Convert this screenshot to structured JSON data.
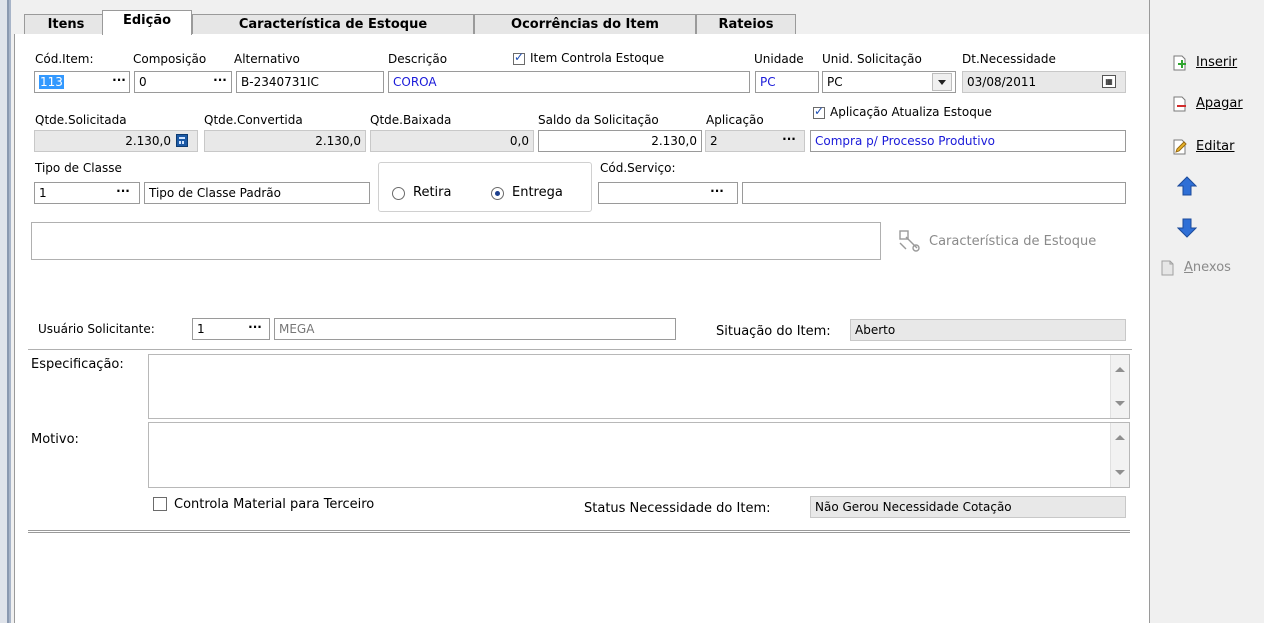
{
  "tabs": [
    "Itens",
    "Edição",
    "Característica de Estoque",
    "Ocorrências do Item",
    "Rateios"
  ],
  "row1": {
    "cod_item_label": "Cód.Item:",
    "cod_item": "113",
    "composicao_label": "Composição",
    "composicao": "0",
    "alternativo_label": "Alternativo",
    "alternativo": "B-2340731IC",
    "descricao_label": "Descrição",
    "descricao": "COROA",
    "item_controla_estoque_label": "Item Controla Estoque",
    "unidade_label": "Unidade",
    "unidade": "PC",
    "unid_solicitacao_label": "Unid. Solicitação",
    "unid_solicitacao": "PC",
    "dt_necessidade_label": "Dt.Necessidade",
    "dt_necessidade": "03/08/2011"
  },
  "row2": {
    "qtde_solicitada_label": "Qtde.Solicitada",
    "qtde_solicitada": "2.130,0",
    "qtde_convertida_label": "Qtde.Convertida",
    "qtde_convertida": "2.130,0",
    "qtde_baixada_label": "Qtde.Baixada",
    "qtde_baixada": "0,0",
    "saldo_label": "Saldo da Solicitação",
    "saldo": "2.130,0",
    "aplicacao_label": "Aplicação",
    "aplicacao": "2",
    "aplicacao_desc": "Compra p/ Processo Produtivo",
    "aplicacao_atualiza_label": "Aplicação Atualiza Estoque"
  },
  "row3": {
    "tipo_classe_label": "Tipo de Classe",
    "tipo_classe": "1",
    "tipo_classe_desc": "Tipo de Classe Padrão",
    "retira_label": "Retira",
    "entrega_label": "Entrega",
    "cod_servico_label": "Cód.Serviço:",
    "cod_servico": "",
    "cod_servico_desc": ""
  },
  "caracteristica_button": "Característica de Estoque",
  "usuario": {
    "label": "Usuário Solicitante:",
    "code": "1",
    "name": "MEGA",
    "situacao_label": "Situação do Item:",
    "situacao": "Aberto"
  },
  "especificacao_label": "Especificação:",
  "motivo_label": "Motivo:",
  "controla_material_label": "Controla Material para Terceiro",
  "status_label": "Status Necessidade do Item:",
  "status": "Não Gerou Necessidade Cotação",
  "side": {
    "inserir": "Inserir",
    "apagar": "Apagar",
    "editar": "Editar",
    "anexos": "Anexos"
  },
  "colors": {
    "accent_blue": "#1a1ad9",
    "arrow_blue": "#2f6fd6"
  }
}
